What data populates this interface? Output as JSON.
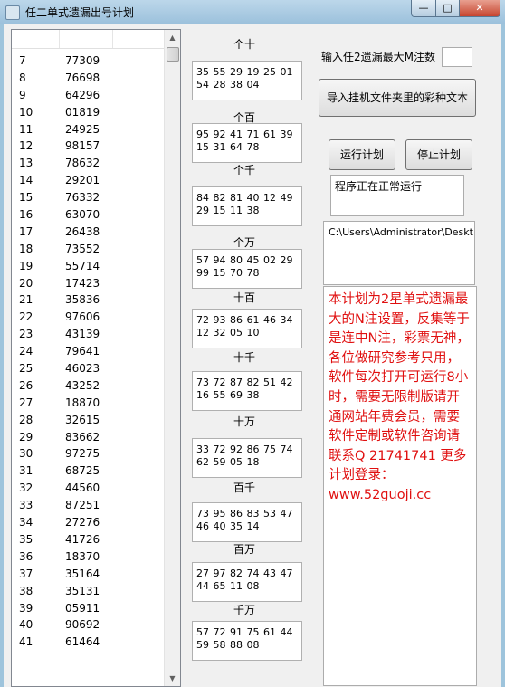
{
  "window": {
    "title": "任二单式遗漏出号计划",
    "controls": {
      "minimize": "—",
      "maximize": "□",
      "close": "✕"
    }
  },
  "list": {
    "rows": [
      {
        "index": "7",
        "value": "77309"
      },
      {
        "index": "8",
        "value": "76698"
      },
      {
        "index": "9",
        "value": "64296"
      },
      {
        "index": "10",
        "value": "01819"
      },
      {
        "index": "11",
        "value": "24925"
      },
      {
        "index": "12",
        "value": "98157"
      },
      {
        "index": "13",
        "value": "78632"
      },
      {
        "index": "14",
        "value": "29201"
      },
      {
        "index": "15",
        "value": "76332"
      },
      {
        "index": "16",
        "value": "63070"
      },
      {
        "index": "17",
        "value": "26438"
      },
      {
        "index": "18",
        "value": "73552"
      },
      {
        "index": "19",
        "value": "55714"
      },
      {
        "index": "20",
        "value": "17423"
      },
      {
        "index": "21",
        "value": "35836"
      },
      {
        "index": "22",
        "value": "97606"
      },
      {
        "index": "23",
        "value": "43139"
      },
      {
        "index": "24",
        "value": "79641"
      },
      {
        "index": "25",
        "value": "46023"
      },
      {
        "index": "26",
        "value": "43252"
      },
      {
        "index": "27",
        "value": "18870"
      },
      {
        "index": "28",
        "value": "32615"
      },
      {
        "index": "29",
        "value": "83662"
      },
      {
        "index": "30",
        "value": "97275"
      },
      {
        "index": "31",
        "value": "68725"
      },
      {
        "index": "32",
        "value": "44560"
      },
      {
        "index": "33",
        "value": "87251"
      },
      {
        "index": "34",
        "value": "27276"
      },
      {
        "index": "35",
        "value": "41726"
      },
      {
        "index": "36",
        "value": "18370"
      },
      {
        "index": "37",
        "value": "35164"
      },
      {
        "index": "38",
        "value": "35131"
      },
      {
        "index": "39",
        "value": "05911"
      },
      {
        "index": "40",
        "value": "90692"
      },
      {
        "index": "41",
        "value": "61464"
      }
    ]
  },
  "sections": [
    {
      "label": "个十",
      "numbers": "35 55 29 19 25 01 54 28 38 04"
    },
    {
      "label": "个百",
      "numbers": "95 92 41 71 61 39 15 31 64 78"
    },
    {
      "label": "个千",
      "numbers": "84 82 81 40 12 49 29 15 11 38"
    },
    {
      "label": "个万",
      "numbers": "57 94 80 45 02 29 99 15 70 78"
    },
    {
      "label": "十百",
      "numbers": "72 93 86 61 46 34 12 32 05 10"
    },
    {
      "label": "十千",
      "numbers": "73 72 87 82 51 42 16 55 69 38"
    },
    {
      "label": "十万",
      "numbers": "33 72 92 86 75 74 62 59 05 18"
    },
    {
      "label": "百千",
      "numbers": "73 95 86 83 53 47 46 40 35 14"
    },
    {
      "label": "百万",
      "numbers": "27 97 82 74 43 47 44 65 11 08"
    },
    {
      "label": "千万",
      "numbers": "57 72 91 75 61 44 59 58 88 08"
    }
  ],
  "settings": {
    "max_m_label": "输入任2遗漏最大M注数",
    "max_m_value": ""
  },
  "buttons": {
    "import": "导入挂机文件夹里的彩种文本",
    "run": "运行计划",
    "stop": "停止计划"
  },
  "status": "程序正在正常运行",
  "path": "C:\\Users\\Administrator\\Deskt",
  "info_text": "本计划为2星单式遗漏最大的N注设置，反集等于是连中N注，彩票无神，各位做研究参考只用，软件每次打开可运行8小时，需要无限制版请开通网站年费会员，需要软件定制或软件咨询请联系Q 21741741 更多计划登录：www.52guoji.cc",
  "colors": {
    "info_text": "#e01010",
    "window_chrome": "#9ec4dc"
  }
}
